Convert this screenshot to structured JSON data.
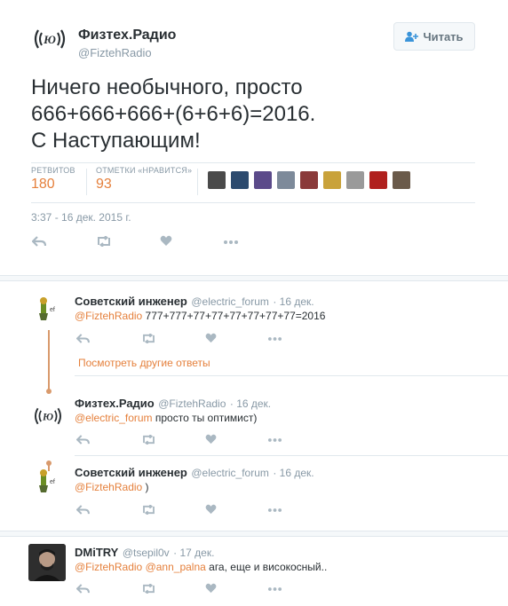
{
  "main": {
    "author_name": "Физтех.Радио",
    "author_handle": "@FiztehRadio",
    "follow_label": "Читать",
    "text_line1": "Ничего необычного, просто",
    "text_line2": "666+666+666+(6+6+6)=2016.",
    "text_line3": "С Наступающим!",
    "retweets_label": "РЕТВИТОВ",
    "retweets_count": "180",
    "likes_label": "ОТМЕТКИ «НРАВИТСЯ»",
    "likes_count": "93",
    "timestamp": "3:37 - 16 дек. 2015 г."
  },
  "replies": [
    {
      "name": "Советский инженер",
      "handle": "@electric_forum",
      "date": "· 16 дек.",
      "mention": "@FiztehRadio",
      "text": " 777+777+77+77+77+77+77+77=2016"
    },
    {
      "more_link": "Посмотреть другие ответы"
    },
    {
      "name": "Физтех.Радио",
      "handle": "@FiztehRadio",
      "date": "· 16 дек.",
      "mention": "@electric_forum",
      "text": " просто ты оптимист)"
    },
    {
      "name": "Советский инженер",
      "handle": "@electric_forum",
      "date": "· 16 дек.",
      "mention": "@FiztehRadio",
      "text": " )"
    },
    {
      "name": "DMiTRY",
      "handle": "@tsepil0v",
      "date": "· 17 дек.",
      "mention": "@FiztehRadio",
      "mention2": "@ann_palna",
      "text": " ага, еще и високосный.."
    }
  ],
  "colors": {
    "accent": "#e5803c",
    "muted": "#8899a6",
    "icon": "#aab8c2",
    "thread": "#d99a6c"
  }
}
